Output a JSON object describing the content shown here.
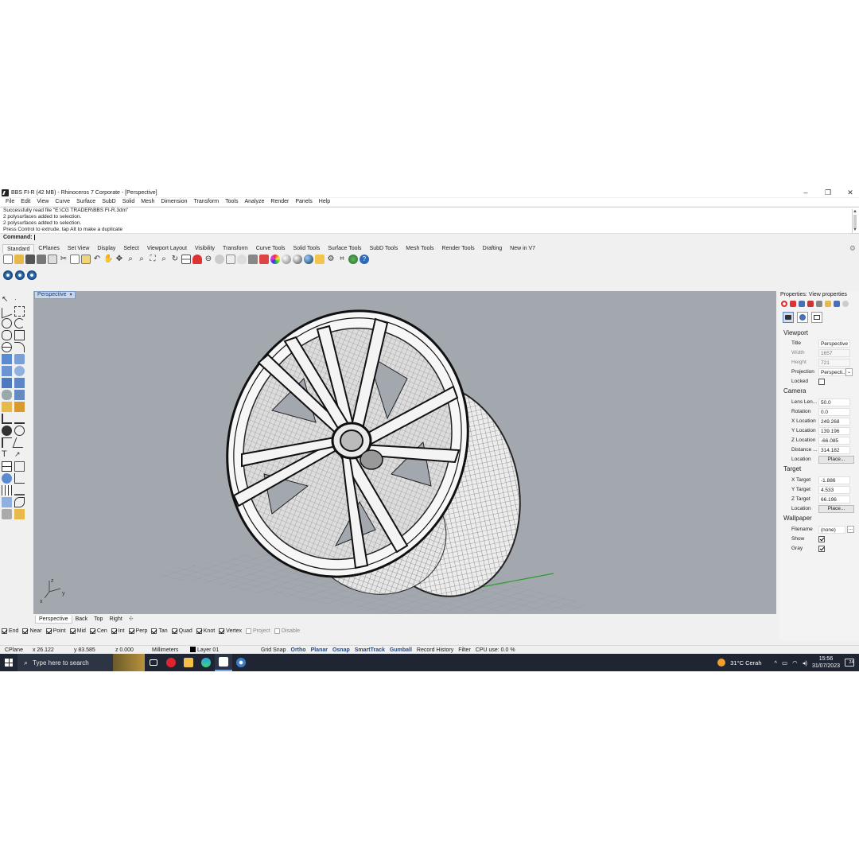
{
  "window": {
    "title": "BBS FI-R (42 MB) - Rhinoceros 7 Corporate - [Perspective]",
    "minimize": "–",
    "restore": "❐",
    "close": "✕"
  },
  "menu": [
    "File",
    "Edit",
    "View",
    "Curve",
    "Surface",
    "SubD",
    "Solid",
    "Mesh",
    "Dimension",
    "Transform",
    "Tools",
    "Analyze",
    "Render",
    "Panels",
    "Help"
  ],
  "command_history": [
    "Successfully read file \"E:\\CG TRADER\\BBS FI-R.3dm\"",
    "2 polysurfaces added to selection.",
    "2 polysurfaces added to selection.",
    "Press Control to extrude, tap Alt to make a duplicate"
  ],
  "command_prompt": "Command:",
  "toolbar_tabs": [
    "Standard",
    "CPlanes",
    "Set View",
    "Display",
    "Select",
    "Viewport Layout",
    "Visibility",
    "Transform",
    "Curve Tools",
    "Solid Tools",
    "Surface Tools",
    "SubD Tools",
    "Mesh Tools",
    "Render Tools",
    "Drafting",
    "New in V7"
  ],
  "viewport": {
    "label": "Perspective",
    "axis_x": "x",
    "axis_y": "y",
    "axis_z": "z",
    "background": "#a3a8ae"
  },
  "view_tabs": [
    "Perspective",
    "Back",
    "Top",
    "Right"
  ],
  "view_tab_add": "✣",
  "osnaps": [
    {
      "label": "End",
      "checked": true
    },
    {
      "label": "Near",
      "checked": true
    },
    {
      "label": "Point",
      "checked": true
    },
    {
      "label": "Mid",
      "checked": true
    },
    {
      "label": "Cen",
      "checked": true
    },
    {
      "label": "Int",
      "checked": true
    },
    {
      "label": "Perp",
      "checked": true
    },
    {
      "label": "Tan",
      "checked": true
    },
    {
      "label": "Quad",
      "checked": true
    },
    {
      "label": "Knot",
      "checked": true
    },
    {
      "label": "Vertex",
      "checked": true
    },
    {
      "label": "Project",
      "checked": false
    },
    {
      "label": "Disable",
      "checked": false
    }
  ],
  "status": {
    "cplane": "CPlane",
    "x": "x 26.122",
    "y": "y 83.585",
    "z": "z 0.000",
    "units": "Millimeters",
    "layer": "Layer 01",
    "grid_snap": "Grid Snap",
    "ortho": "Ortho",
    "planar": "Planar",
    "osnap": "Osnap",
    "smarttrack": "SmartTrack",
    "gumball": "Gumball",
    "record_history": "Record History",
    "filter": "Filter",
    "cpu": "CPU use: 0.0 %"
  },
  "properties": {
    "header": "Properties: View properties",
    "viewport_section": "Viewport",
    "title_label": "Title",
    "title_value": "Perspective",
    "width_label": "Width",
    "width_value": "1657",
    "height_label": "Height",
    "height_value": "721",
    "projection_label": "Projection",
    "projection_value": "Perspecti...",
    "locked_label": "Locked",
    "camera_section": "Camera",
    "lens_label": "Lens Len...",
    "lens_value": "50.0",
    "rotation_label": "Rotation",
    "rotation_value": "0.0",
    "xloc_label": "X Location",
    "xloc_value": "249.268",
    "yloc_label": "Y Location",
    "yloc_value": "139.196",
    "zloc_label": "Z Location",
    "zloc_value": "-66.085",
    "distance_label": "Distance ...",
    "distance_value": "314.182",
    "location_label": "Location",
    "place_button": "Place...",
    "target_section": "Target",
    "xtarget_label": "X Target",
    "xtarget_value": "-1.886",
    "ytarget_label": "Y Target",
    "ytarget_value": "4.533",
    "ztarget_label": "Z Target",
    "ztarget_value": "66.196",
    "tlocation_label": "Location",
    "tplace_button": "Place...",
    "wallpaper_section": "Wallpaper",
    "filename_label": "Filename",
    "filename_value": "(none)",
    "filename_button": "...",
    "show_label": "Show",
    "gray_label": "Gray"
  },
  "taskbar": {
    "search_placeholder": "Type here to search",
    "weather": "31°C  Cerah",
    "time": "15:56",
    "date": "31/07/2023",
    "notifications": "24"
  }
}
